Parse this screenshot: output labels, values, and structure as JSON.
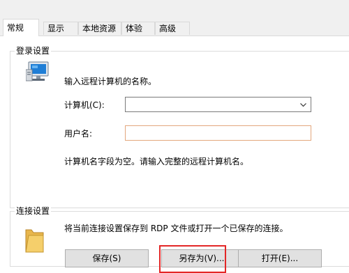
{
  "tabs": [
    {
      "label": "常规"
    },
    {
      "label": "显示"
    },
    {
      "label": "本地资源"
    },
    {
      "label": "体验"
    },
    {
      "label": "高级"
    }
  ],
  "login_settings": {
    "title": "登录设置",
    "prompt": "输入远程计算机的名称。",
    "computer_label": "计算机(C):",
    "computer_value": "",
    "username_label": "用户名:",
    "username_value": "",
    "warning": "计算机名字段为空。请输入完整的远程计算机名。"
  },
  "connection_settings": {
    "title": "连接设置",
    "description": "将当前连接设置保存到 RDP 文件或打开一个已保存的连接。",
    "buttons": {
      "save": "保存(S)",
      "save_as": "另存为(V)...",
      "open": "打开(E)..."
    }
  },
  "colors": {
    "highlight": "#e32626",
    "warning_border": "#e3a77d"
  },
  "icons": {
    "computer": "computer-monitor-icon",
    "folder": "folder-icon",
    "dropdown": "chevron-down-icon"
  }
}
